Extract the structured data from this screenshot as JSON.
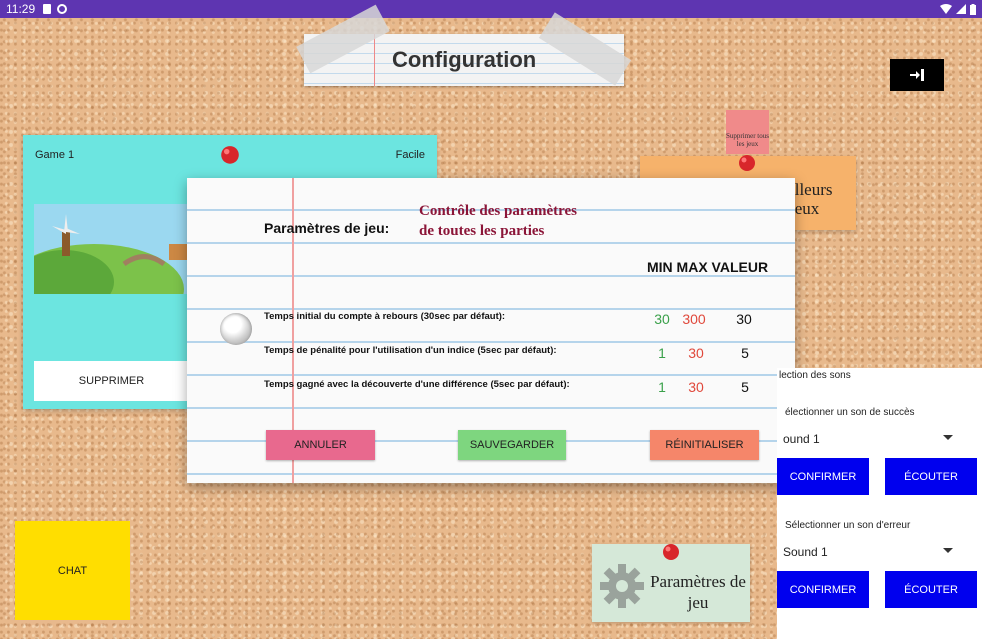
{
  "status_bar": {
    "time": "11:29"
  },
  "title": "Configuration",
  "sticky_delete_all": "Supprimer tous les jeux",
  "best_scores_note": "illeurs\njeux",
  "game_card": {
    "name": "Game 1",
    "difficulty": "Facile",
    "delete_label": "SUPPRIMER"
  },
  "modal": {
    "section_label": "Paramètres de jeu:",
    "heading_line1": "Contrôle des paramètres",
    "heading_line2": "de toutes les parties",
    "columns_header": "MIN MAX VALEUR",
    "rows": [
      {
        "label": "Temps initial du compte à rebours (30sec par défaut):",
        "min": "30",
        "max": "300",
        "value": "30"
      },
      {
        "label": "Temps de pénalité pour l'utilisation d'un indice (5sec par défaut):",
        "min": "1",
        "max": "30",
        "value": "5"
      },
      {
        "label": "Temps gagné avec la découverte d'une différence (5sec par défaut):",
        "min": "1",
        "max": "30",
        "value": "5"
      }
    ],
    "cancel_label": "ANNULER",
    "save_label": "SAUVEGARDER",
    "reset_label": "RÉINITIALISER",
    "colors": {
      "cancel": "#e8698e",
      "save": "#7ed67f",
      "reset": "#f5866a"
    }
  },
  "sound_panel": {
    "section_title": "lection des sons",
    "success_label": "électionner un son de succès",
    "success_value": "ound 1",
    "error_label": "Sélectionner un son d'erreur",
    "error_value": "Sound 1",
    "confirm_label": "CONFIRMER",
    "listen_label": "ÉCOUTER"
  },
  "chat_label": "CHAT",
  "game_params_note": "Paramètres de jeu"
}
